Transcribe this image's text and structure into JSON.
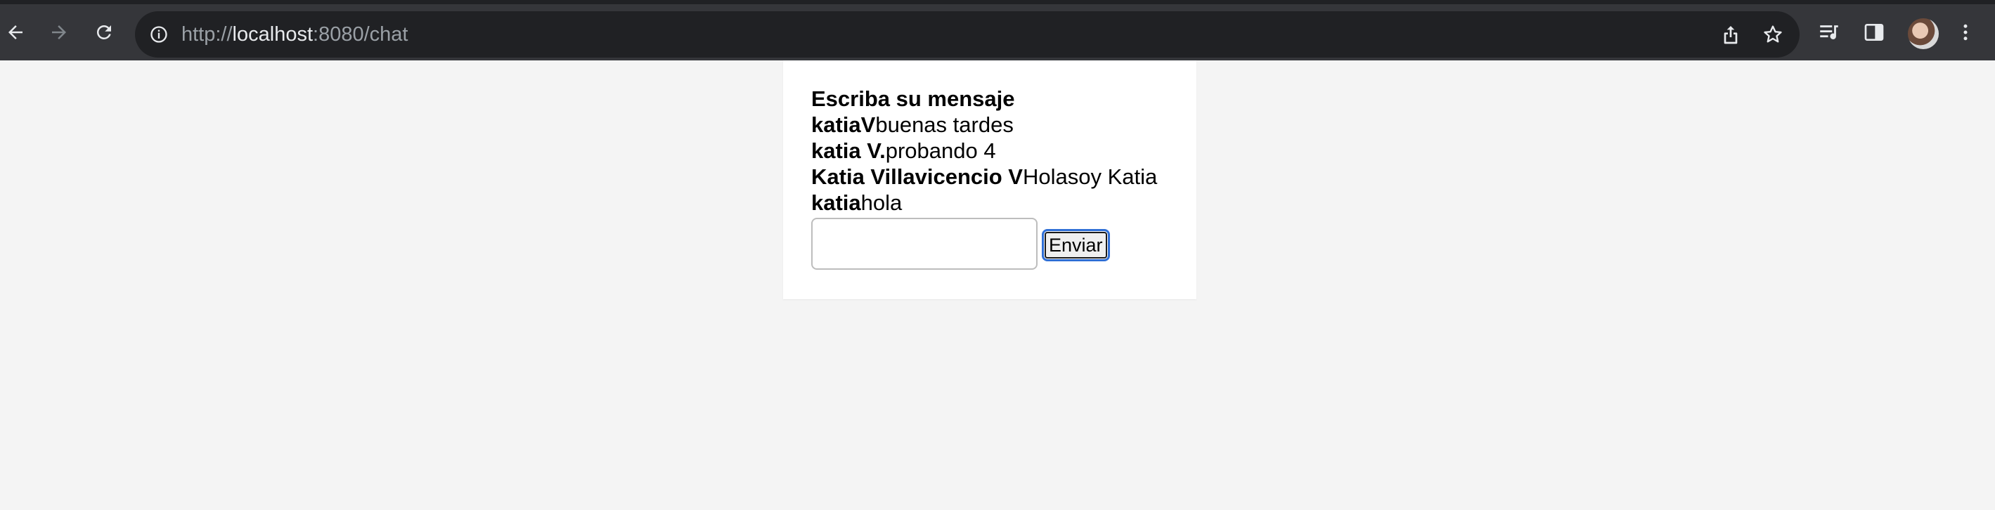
{
  "browser": {
    "url_scheme": "http://",
    "url_host": "localhost",
    "url_rest": ":8080/chat",
    "icons": {
      "back": "back-arrow-icon",
      "forward": "forward-arrow-icon",
      "reload": "reload-icon",
      "site_info": "info-icon",
      "share": "share-icon",
      "bookmark": "star-icon",
      "media": "media-playlist-icon",
      "side_panel": "side-panel-icon",
      "menu": "kebab-menu-icon"
    },
    "colors": {
      "toolbar": "#35363a",
      "omnibox": "#202124",
      "page_background": "#f4f4f4"
    }
  },
  "chat": {
    "title": "Escriba su mensaje",
    "messages": [
      {
        "user": "katiaV",
        "text": "buenas tardes"
      },
      {
        "user": "katia V.",
        "text": "probando 4"
      },
      {
        "user": "Katia Villavicencio V",
        "text": "Holasoy Katia"
      },
      {
        "user": "katia",
        "text": "hola"
      }
    ],
    "input_value": "",
    "send_label": "Enviar"
  }
}
